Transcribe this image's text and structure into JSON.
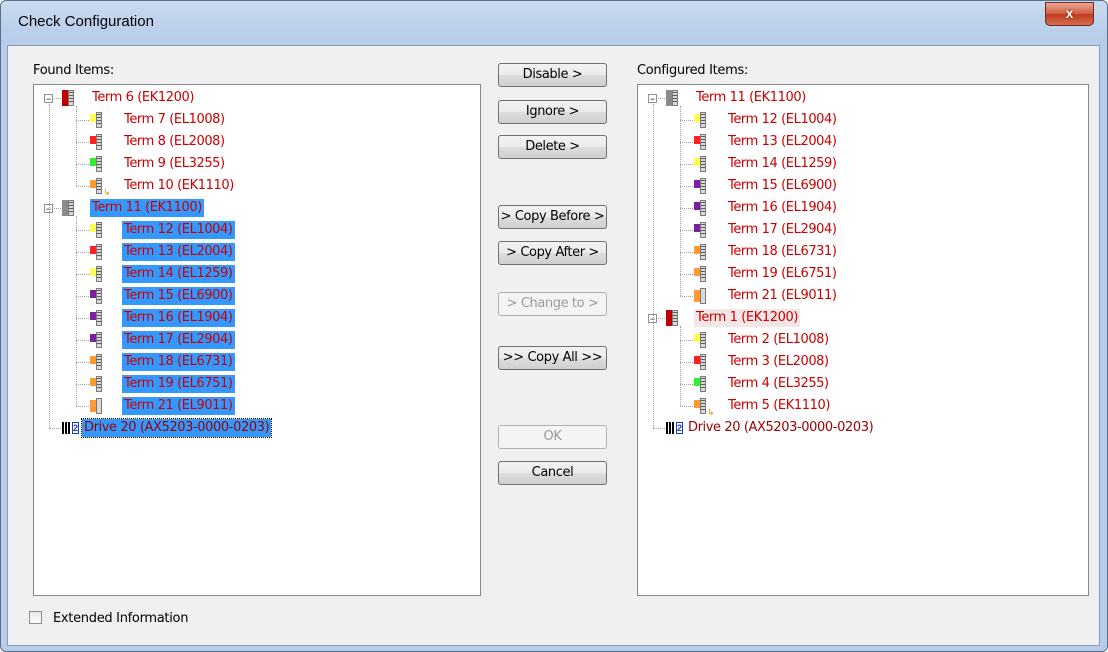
{
  "window": {
    "title": "Check Configuration",
    "close_label": "x"
  },
  "found": {
    "label": "Found Items:",
    "items": [
      {
        "text": "Term 6 (EK1200)",
        "icon": "bus-coupler-red-icon",
        "color": "#c00000",
        "selected": false
      },
      {
        "text": "Term 7 (EL1008)",
        "icon": "terminal-icon",
        "color": "#ffff55",
        "selected": false
      },
      {
        "text": "Term 8 (EL2008)",
        "icon": "terminal-icon",
        "color": "#ff2020",
        "selected": false
      },
      {
        "text": "Term 9 (EL3255)",
        "icon": "terminal-icon",
        "color": "#33ee33",
        "selected": false
      },
      {
        "text": "Term 10 (EK1110)",
        "icon": "extension-terminal-icon",
        "color": "#ff9933",
        "selected": false
      },
      {
        "text": "Term 11 (EK1100)",
        "icon": "bus-coupler-grey-icon",
        "color": "#8a8a8a",
        "selected": true
      },
      {
        "text": "Term 12 (EL1004)",
        "icon": "terminal-icon",
        "color": "#ffff55",
        "selected": true
      },
      {
        "text": "Term 13 (EL2004)",
        "icon": "terminal-icon",
        "color": "#ff2020",
        "selected": true
      },
      {
        "text": "Term 14 (EL1259)",
        "icon": "terminal-icon",
        "color": "#ffff55",
        "selected": true
      },
      {
        "text": "Term 15 (EL6900)",
        "icon": "terminal-icon",
        "color": "#7a1fa0",
        "selected": true
      },
      {
        "text": "Term 16 (EL1904)",
        "icon": "terminal-icon",
        "color": "#7a1fa0",
        "selected": true
      },
      {
        "text": "Term 17 (EL2904)",
        "icon": "terminal-icon",
        "color": "#7a1fa0",
        "selected": true
      },
      {
        "text": "Term 18 (EL6731)",
        "icon": "profibus-terminal-icon",
        "color": "#ff9933",
        "selected": true
      },
      {
        "text": "Term 19 (EL6751)",
        "icon": "canopen-terminal-icon",
        "color": "#ff9933",
        "selected": true
      },
      {
        "text": "Term 21 (EL9011)",
        "icon": "end-terminal-icon",
        "color": "#ff9933",
        "selected": true
      },
      {
        "text": "Drive 20 (AX5203-0000-0203)",
        "icon": "drive-icon",
        "color": "#1d3ea8",
        "selected": true
      }
    ]
  },
  "configured": {
    "label": "Configured Items:",
    "items": [
      {
        "text": "Term 11 (EK1100)",
        "icon": "bus-coupler-grey-icon",
        "color": "#8a8a8a"
      },
      {
        "text": "Term 12 (EL1004)",
        "icon": "terminal-icon",
        "color": "#ffff55"
      },
      {
        "text": "Term 13 (EL2004)",
        "icon": "terminal-icon",
        "color": "#ff2020"
      },
      {
        "text": "Term 14 (EL1259)",
        "icon": "terminal-icon",
        "color": "#ffff55"
      },
      {
        "text": "Term 15 (EL6900)",
        "icon": "terminal-icon",
        "color": "#7a1fa0"
      },
      {
        "text": "Term 16 (EL1904)",
        "icon": "terminal-icon",
        "color": "#7a1fa0"
      },
      {
        "text": "Term 17 (EL2904)",
        "icon": "terminal-icon",
        "color": "#7a1fa0"
      },
      {
        "text": "Term 18 (EL6731)",
        "icon": "profibus-terminal-icon",
        "color": "#ff9933"
      },
      {
        "text": "Term 19 (EL6751)",
        "icon": "canopen-terminal-icon",
        "color": "#ff9933"
      },
      {
        "text": "Term 21 (EL9011)",
        "icon": "end-terminal-icon",
        "color": "#ff9933"
      },
      {
        "text": "Term 1 (EK1200)",
        "icon": "bus-coupler-red-icon",
        "color": "#c00000"
      },
      {
        "text": "Term 2 (EL1008)",
        "icon": "terminal-icon",
        "color": "#ffff55"
      },
      {
        "text": "Term 3 (EL2008)",
        "icon": "terminal-icon",
        "color": "#ff2020"
      },
      {
        "text": "Term 4 (EL3255)",
        "icon": "terminal-icon",
        "color": "#33ee33"
      },
      {
        "text": "Term 5 (EK1110)",
        "icon": "extension-terminal-icon",
        "color": "#ff9933"
      },
      {
        "text": "Drive 20 (AX5203-0000-0203)",
        "icon": "drive-icon",
        "color": "#1d3ea8"
      }
    ]
  },
  "buttons": {
    "disable": "Disable >",
    "ignore": "Ignore >",
    "delete": "Delete >",
    "copy_before": "> Copy Before >",
    "copy_after": "> Copy After >",
    "change_to": "> Change to >",
    "copy_all": ">> Copy All >>",
    "ok": "OK",
    "cancel": "Cancel"
  },
  "extended": {
    "label": "Extended Information",
    "checked": false
  }
}
